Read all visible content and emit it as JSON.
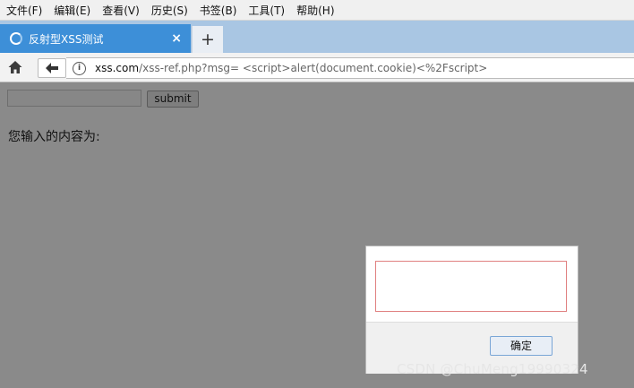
{
  "menubar": {
    "items": [
      "文件(F)",
      "编辑(E)",
      "查看(V)",
      "历史(S)",
      "书签(B)",
      "工具(T)",
      "帮助(H)"
    ]
  },
  "tab": {
    "title": "反射型XSS测试",
    "close_glyph": "×",
    "new_tab_glyph": "+"
  },
  "navbar": {
    "url_domain": "xss.com",
    "url_path": "/xss-ref.php?msg= <script>alert(document.cookie)<%2Fscript>",
    "info_glyph": "i"
  },
  "page": {
    "input_value": "",
    "submit_label": "submit",
    "output_label": "您输入的内容为:"
  },
  "dialog": {
    "message": "",
    "ok_label": "确定"
  },
  "watermark": "CSDN @ChuMeng19990324",
  "colors": {
    "tab_active": "#3d8fd8",
    "overlay": "#8a8a8a"
  }
}
